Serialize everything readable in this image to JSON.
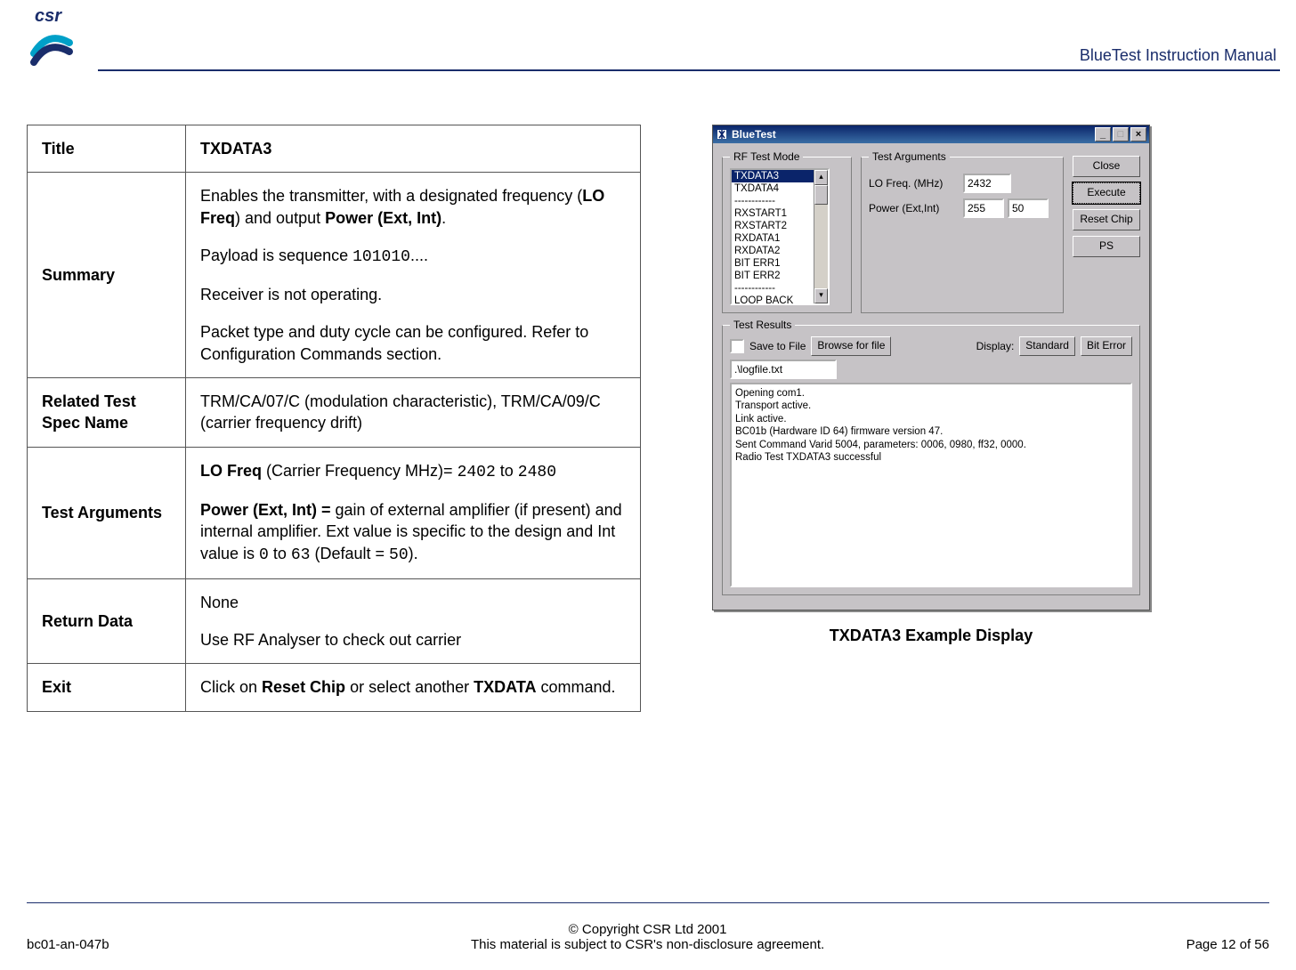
{
  "header": {
    "doc_title": "BlueTest Instruction Manual",
    "logo_text": "csr"
  },
  "spec_table": {
    "title_label": "Title",
    "title_value": "TXDATA3",
    "summary_label": "Summary",
    "summary_p1_a": "Enables the transmitter, with a designated frequency  (",
    "summary_p1_b": "LO Freq",
    "summary_p1_c": ")   and output ",
    "summary_p1_d": "Power (Ext, Int)",
    "summary_p1_e": ".",
    "summary_p2_a": "Payload is sequence ",
    "summary_p2_b": "101010",
    "summary_p2_c": "....",
    "summary_p3": "Receiver is not operating.",
    "summary_p4": "Packet type and duty cycle can be configured. Refer to Configuration Commands section.",
    "related_label": "Related Test Spec Name",
    "related_value": "TRM/CA/07/C (modulation characteristic), TRM/CA/09/C (carrier frequency drift)",
    "args_label": "Test Arguments",
    "args_p1_a": "LO Freq ",
    "args_p1_b": "(Carrier Frequency MHz)= ",
    "args_p1_c": "2402",
    "args_p1_d": " to ",
    "args_p1_e": "2480",
    "args_p2_a": "Power (Ext, Int) = ",
    "args_p2_b": "gain of external amplifier (if present) and internal amplifier. Ext value is specific to the design and Int value is ",
    "args_p2_c": "0",
    "args_p2_d": " to ",
    "args_p2_e": "63",
    "args_p2_f": " (Default = ",
    "args_p2_g": "50",
    "args_p2_h": ").",
    "return_label": "Return Data",
    "return_p1": "None",
    "return_p2": "Use RF Analyser to check out carrier",
    "exit_label": "Exit",
    "exit_a": "Click on ",
    "exit_b": "Reset Chip",
    "exit_c": " or select another ",
    "exit_d": "TXDATA",
    "exit_e": " command."
  },
  "app_window": {
    "title": "BlueTest",
    "rf_group": "RF Test Mode",
    "list_items": [
      "TXDATA3",
      "TXDATA4",
      "------------",
      "RXSTART1",
      "RXSTART2",
      "RXDATA1",
      "RXDATA2",
      "BIT ERR1",
      "BIT ERR2",
      "------------",
      "LOOP BACK"
    ],
    "selected_index": 0,
    "args_group": "Test Arguments",
    "arg1_label": "LO Freq. (MHz)",
    "arg1_value": "2432",
    "arg2_label": "Power (Ext,Int)",
    "arg2_value_a": "255",
    "arg2_value_b": "50",
    "buttons": {
      "close": "Close",
      "execute": "Execute",
      "reset": "Reset Chip",
      "ps": "PS"
    },
    "results_group": "Test Results",
    "save_to_file_label": "Save to File",
    "browse_btn": "Browse for file",
    "display_label": "Display:",
    "display_btn_standard": "Standard",
    "display_btn_biterr": "Bit Error",
    "logfile_value": ".\\logfile.txt",
    "results_text": "Opening com1.\nTransport active.\nLink active.\nBC01b (Hardware ID 64) firmware version 47.\nSent Command Varid 5004, parameters: 0006, 0980, ff32, 0000.\nRadio Test TXDATA3 successful"
  },
  "caption": "TXDATA3 Example Display",
  "footer": {
    "left": "bc01-an-047b",
    "center1": "© Copyright CSR Ltd 2001",
    "center2": "This material is subject to CSR's non-disclosure agreement.",
    "right": "Page 12 of 56"
  }
}
